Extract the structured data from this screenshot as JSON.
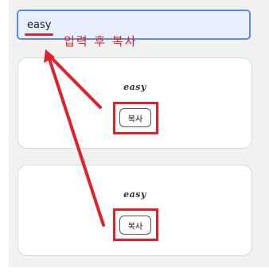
{
  "input": {
    "value": "easy"
  },
  "annotation": {
    "text": "입력 후 복사",
    "color": "#e0202a"
  },
  "cards": [
    {
      "preview_text": "easy",
      "copy_label": "복사"
    },
    {
      "preview_text": "easy",
      "copy_label": "복사"
    }
  ],
  "colors": {
    "input_border": "#5a8ee3",
    "input_background": "#e7eefc",
    "panel_background": "#f1f1f1"
  }
}
